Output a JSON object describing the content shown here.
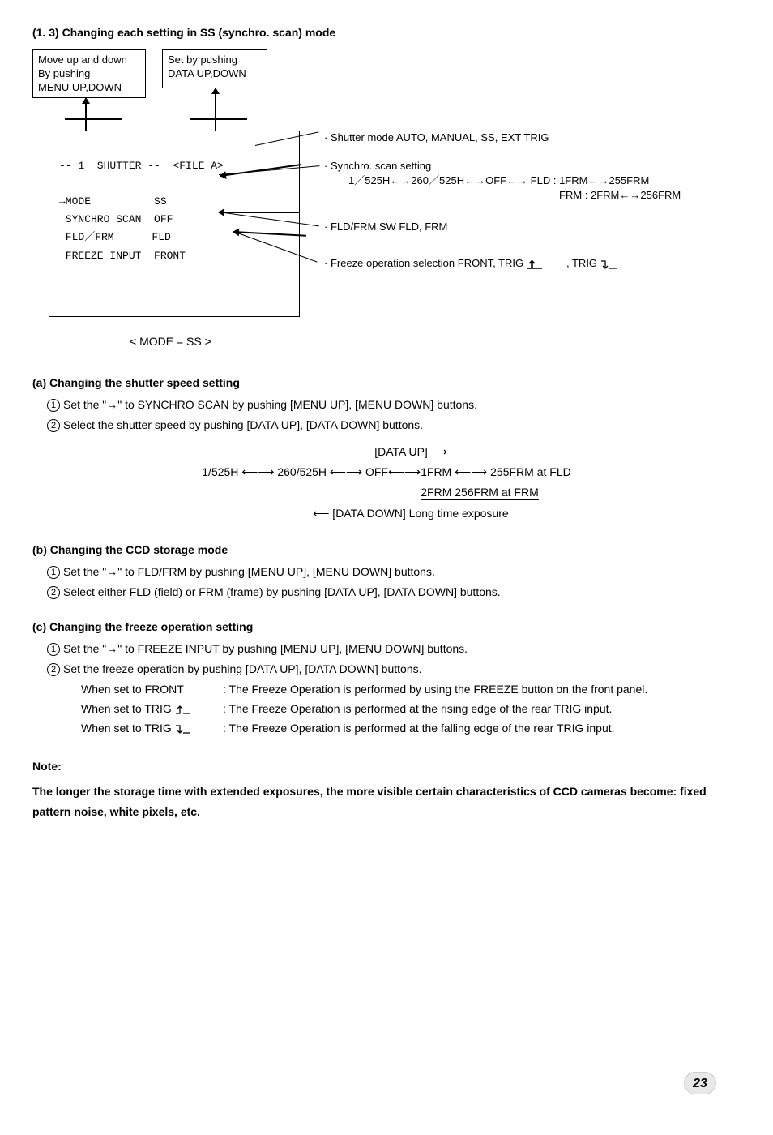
{
  "title": "(1. 3) Changing each setting in SS (synchro. scan) mode",
  "diagram": {
    "box1": "Move up and down\nBy pushing\nMENU UP,DOWN",
    "box2": "Set by pushing\nDATA UP,DOWN",
    "screen": {
      "l1": "-- 1  SHUTTER --  <FILE A>",
      "l2": "→MODE          SS",
      "l3": " SYNCHRO SCAN  OFF",
      "l4": " FLD／FRM      FLD",
      "l5": " FREEZE INPUT  FRONT"
    },
    "annot1": "· Shutter mode   AUTO, MANUAL, SS, EXT TRIG",
    "annot2a": "· Synchro. scan setting",
    "annot2b": "1／525H←→260／525H←→OFF←→  FLD : 1FRM←→255FRM",
    "annot2c": "FRM : 2FRM←→256FRM",
    "annot3": "· FLD/FRM SW   FLD, FRM",
    "annot4": "· Freeze operation selection   FRONT, TRIG",
    "annot4b": ", TRIG",
    "caption": "< MODE = SS >"
  },
  "secA": {
    "h": "(a) Changing the shutter speed setting",
    "s1": "Set the \"→\" to SYNCHRO SCAN by pushing [MENU UP], [MENU DOWN] buttons.",
    "s2": "Select the shutter speed by pushing [DATA UP], [DATA DOWN] buttons.",
    "flow_up": "[DATA UP]  ⟶",
    "flow_main": "1/525H ⟵⟶ 260/525H ⟵⟶ OFF⟵⟶1FRM ⟵⟶ 255FRM   at FLD",
    "flow_sub": "2FRM           256FRM   at FRM",
    "flow_down": "⟵ [DATA DOWN]    Long time exposure"
  },
  "secB": {
    "h": "(b) Changing the CCD storage mode",
    "s1": "Set the \"→\" to FLD/FRM by pushing [MENU UP], [MENU DOWN] buttons.",
    "s2": "Select either FLD (field) or FRM (frame) by pushing [DATA UP], [DATA DOWN] buttons."
  },
  "secC": {
    "h": "(c) Changing the freeze operation setting",
    "s1": "Set the \"→\" to FREEZE INPUT by pushing [MENU UP], [MENU DOWN] buttons.",
    "s2": "Set the freeze operation by pushing [DATA UP], [DATA DOWN] buttons.",
    "d1l": "When set to FRONT",
    "d1t": ": The Freeze Operation is performed by using the FREEZE button on the front panel.",
    "d2l": "When set to TRIG",
    "d2t": ": The Freeze Operation is performed at the rising edge of the rear TRIG input.",
    "d3l": "When set to TRIG",
    "d3t": ": The Freeze Operation is performed at the falling edge of the rear TRIG input."
  },
  "note": {
    "h": "Note:",
    "body": "The longer the storage time with extended exposures, the more visible certain characteristics of CCD cameras become: fixed pattern noise, white pixels, etc."
  },
  "page": "23"
}
